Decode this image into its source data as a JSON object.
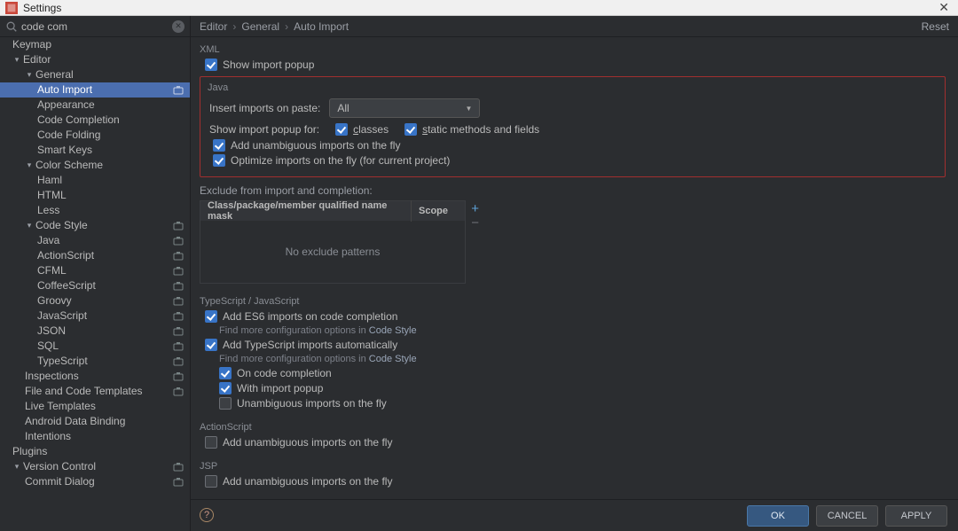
{
  "window": {
    "title": "Settings"
  },
  "search": {
    "value": "code com"
  },
  "breadcrumb": {
    "a": "Editor",
    "b": "General",
    "c": "Auto Import"
  },
  "reset_label": "Reset",
  "tree": {
    "keymap": "Keymap",
    "editor": "Editor",
    "general": "General",
    "auto_import": "Auto Import",
    "appearance": "Appearance",
    "code_completion": "Code Completion",
    "code_folding": "Code Folding",
    "smart_keys": "Smart Keys",
    "color_scheme": "Color Scheme",
    "haml": "Haml",
    "html": "HTML",
    "less": "Less",
    "code_style": "Code Style",
    "java": "Java",
    "actionscript": "ActionScript",
    "cfml": "CFML",
    "coffeescript": "CoffeeScript",
    "groovy": "Groovy",
    "javascript": "JavaScript",
    "json": "JSON",
    "sql": "SQL",
    "typescript": "TypeScript",
    "inspections": "Inspections",
    "file_code_templates": "File and Code Templates",
    "live_templates": "Live Templates",
    "android_data_binding": "Android Data Binding",
    "intentions": "Intentions",
    "plugins": "Plugins",
    "version_control": "Version Control",
    "commit_dialog": "Commit Dialog"
  },
  "xml": {
    "title": "XML",
    "show_import_popup": "Show import popup"
  },
  "java": {
    "title": "Java",
    "insert_label": "Insert imports on paste:",
    "insert_value": "All",
    "show_popup_for": "Show import popup for:",
    "classes_pre": "c",
    "classes_post": "lasses",
    "static_pre": "s",
    "static_post": "tatic methods and fields",
    "add_unambiguous": "Add unambiguous imports on the fly",
    "optimize": "Optimize imports on the fly (for current project)"
  },
  "exclude": {
    "title": "Exclude from import and completion:",
    "col1": "Class/package/member qualified name mask",
    "col2": "Scope",
    "empty": "No exclude patterns"
  },
  "ts": {
    "title": "TypeScript / JavaScript",
    "es6": "Add ES6 imports on code completion",
    "hint1a": "Find more configuration options in ",
    "hint1b": "Code Style",
    "add_ts": "Add TypeScript imports automatically",
    "hint2a": "Find more configuration options in ",
    "hint2b": "Code Style",
    "on_completion": "On code completion",
    "with_popup": "With import popup",
    "unambiguous": "Unambiguous imports on the fly"
  },
  "as": {
    "title": "ActionScript",
    "add_unambiguous": "Add unambiguous imports on the fly"
  },
  "jsp": {
    "title": "JSP",
    "add_unambiguous": "Add unambiguous imports on the fly"
  },
  "buttons": {
    "ok": "OK",
    "cancel": "CANCEL",
    "apply": "APPLY"
  }
}
